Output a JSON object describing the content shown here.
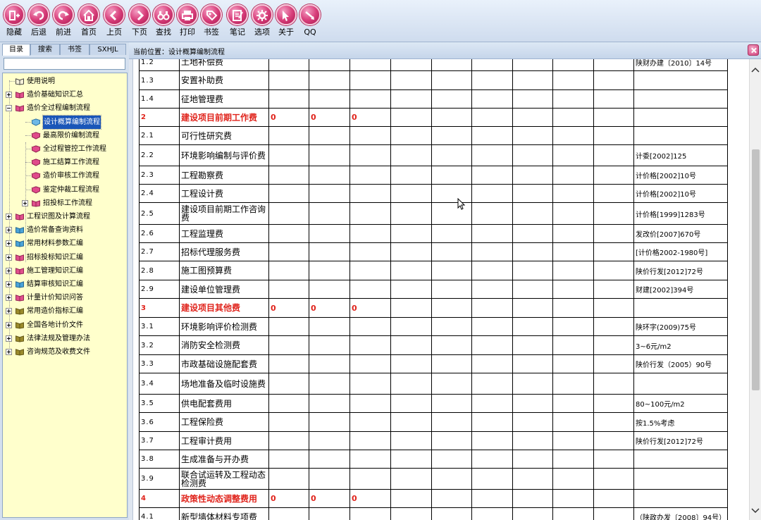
{
  "toolbar": {
    "buttons": [
      {
        "label": "隐藏",
        "icon": "hide-icon"
      },
      {
        "label": "后退",
        "icon": "back-icon"
      },
      {
        "label": "前进",
        "icon": "forward-icon"
      },
      {
        "label": "首页",
        "icon": "home-icon"
      },
      {
        "label": "上页",
        "icon": "prev-page-icon"
      },
      {
        "label": "下页",
        "icon": "next-page-icon"
      },
      {
        "label": "查找",
        "icon": "binoculars-icon"
      },
      {
        "label": "打印",
        "icon": "printer-icon"
      },
      {
        "label": "书签",
        "icon": "bookmark-tag-icon"
      },
      {
        "label": "笔记",
        "icon": "note-icon"
      },
      {
        "label": "选项",
        "icon": "gear-icon"
      },
      {
        "label": "关于",
        "icon": "cursor-icon"
      },
      {
        "label": "QQ",
        "icon": "qq-icon"
      }
    ]
  },
  "sidebar": {
    "tabs": [
      "目录",
      "搜索",
      "书签",
      "SXHJL"
    ],
    "search": {
      "value": "",
      "placeholder": ""
    },
    "tree": [
      {
        "label": "使用说明",
        "icon": "book-icon",
        "expander": "none"
      },
      {
        "label": "造价基础知识汇总",
        "icon": "pink-book-icon",
        "expander": "plus"
      },
      {
        "label": "造价全过程编制流程",
        "icon": "pink-book-icon",
        "expander": "minus"
      },
      {
        "label": "设计概算编制流程",
        "icon": "blue-doc-icon",
        "expander": "none",
        "selected": true
      },
      {
        "label": "最高限价编制流程",
        "icon": "pink-doc-icon",
        "expander": "none"
      },
      {
        "label": "全过程管控工作流程",
        "icon": "pink-doc-icon",
        "expander": "none"
      },
      {
        "label": "施工结算工作流程",
        "icon": "pink-doc-icon",
        "expander": "none"
      },
      {
        "label": "造价审核工作流程",
        "icon": "pink-doc-icon",
        "expander": "none"
      },
      {
        "label": "鉴定仲裁工程流程",
        "icon": "pink-doc-icon",
        "expander": "none"
      },
      {
        "label": "招投标工作流程",
        "icon": "pink-book-icon",
        "expander": "plus"
      },
      {
        "label": "工程识图及计算流程",
        "icon": "pink-book-icon",
        "expander": "plus"
      },
      {
        "label": "造价常备查询资料",
        "icon": "blue-book-icon",
        "expander": "plus"
      },
      {
        "label": "常用材料参数汇编",
        "icon": "blue-book-icon",
        "expander": "plus"
      },
      {
        "label": "招标投标知识汇编",
        "icon": "pink-book-icon",
        "expander": "plus"
      },
      {
        "label": "施工管理知识汇编",
        "icon": "pink-book-icon",
        "expander": "plus"
      },
      {
        "label": "结算审核知识汇编",
        "icon": "blue-book-icon",
        "expander": "plus"
      },
      {
        "label": "计量计价知识问答",
        "icon": "pink-book-icon",
        "expander": "plus"
      },
      {
        "label": "常用造价指标汇编",
        "icon": "olive-book-icon",
        "expander": "plus"
      },
      {
        "label": "全国各地计价文件",
        "icon": "olive-book-icon",
        "expander": "plus"
      },
      {
        "label": "法律法规及管理办法",
        "icon": "olive-book-icon",
        "expander": "plus"
      },
      {
        "label": "咨询规范及收费文件",
        "icon": "olive-book-icon",
        "expander": "plus"
      }
    ]
  },
  "main": {
    "breadcrumb": "当前位置：设计概算编制流程",
    "rows": [
      {
        "no": "1.2",
        "name": "土地补偿费",
        "values": [
          "",
          "",
          ""
        ],
        "ref": "陕财办建〔2010〕14号",
        "section": false
      },
      {
        "no": "1.3",
        "name": "安置补助费",
        "values": [
          "",
          "",
          ""
        ],
        "ref": "",
        "section": false
      },
      {
        "no": "1.4",
        "name": "征地管理费",
        "values": [
          "",
          "",
          ""
        ],
        "ref": "",
        "section": false
      },
      {
        "no": "2",
        "name": "建设项目前期工作费",
        "values": [
          "0",
          "0",
          "0"
        ],
        "ref": "",
        "section": true
      },
      {
        "no": "2.1",
        "name": "可行性研究费",
        "values": [
          "",
          "",
          ""
        ],
        "ref": "",
        "section": false
      },
      {
        "no": "2.2",
        "name": "环境影响编制与评价费",
        "values": [
          "",
          "",
          ""
        ],
        "ref": "计委[2002]125",
        "section": false
      },
      {
        "no": "2.3",
        "name": "工程勘察费",
        "values": [
          "",
          "",
          ""
        ],
        "ref": "计价格[2002]10号",
        "section": false
      },
      {
        "no": "2.4",
        "name": "工程设计费",
        "values": [
          "",
          "",
          ""
        ],
        "ref": "计价格[2002]10号",
        "section": false
      },
      {
        "no": "2.5",
        "name": "建设项目前期工作咨询费",
        "values": [
          "",
          "",
          ""
        ],
        "ref": "计价格[1999]1283号",
        "section": false
      },
      {
        "no": "2.6",
        "name": "工程监理费",
        "values": [
          "",
          "",
          ""
        ],
        "ref": "发改价[2007]670号",
        "section": false
      },
      {
        "no": "2.7",
        "name": "招标代理服务费",
        "values": [
          "",
          "",
          ""
        ],
        "ref": "[计价格2002-1980号]",
        "section": false
      },
      {
        "no": "2.8",
        "name": "施工图预算费",
        "values": [
          "",
          "",
          ""
        ],
        "ref": "陕价行发[2012]72号",
        "section": false
      },
      {
        "no": "2.9",
        "name": "建设单位管理费",
        "values": [
          "",
          "",
          ""
        ],
        "ref": "财建[2002]394号",
        "section": false
      },
      {
        "no": "3",
        "name": "建设项目其他费",
        "values": [
          "0",
          "0",
          "0"
        ],
        "ref": "",
        "section": true
      },
      {
        "no": "3.1",
        "name": "环境影响评价检测费",
        "values": [
          "",
          "",
          ""
        ],
        "ref": "陕环字(2009)75号",
        "section": false
      },
      {
        "no": "3.2",
        "name": "消防安全检测费",
        "values": [
          "",
          "",
          ""
        ],
        "ref": "3~6元/m2",
        "section": false
      },
      {
        "no": "3.3",
        "name": "市政基础设施配套费",
        "values": [
          "",
          "",
          ""
        ],
        "ref": "陕价行发（2005）90号",
        "section": false
      },
      {
        "no": "3.4",
        "name": "场地准备及临时设施费",
        "values": [
          "",
          "",
          ""
        ],
        "ref": "",
        "section": false
      },
      {
        "no": "3.5",
        "name": "供电配套费用",
        "values": [
          "",
          "",
          ""
        ],
        "ref": "80~100元/m2",
        "section": false
      },
      {
        "no": "3.6",
        "name": "工程保险费",
        "values": [
          "",
          "",
          ""
        ],
        "ref": "按1.5%考虑",
        "section": false
      },
      {
        "no": "3.7",
        "name": "工程审计费用",
        "values": [
          "",
          "",
          ""
        ],
        "ref": "陕价行发[2012]72号",
        "section": false
      },
      {
        "no": "3.8",
        "name": "生成准备与开办费",
        "values": [
          "",
          "",
          ""
        ],
        "ref": "",
        "section": false
      },
      {
        "no": "3.9",
        "name": "联合试运转及工程动态检测费",
        "values": [
          "",
          "",
          ""
        ],
        "ref": "",
        "section": false
      },
      {
        "no": "4",
        "name": "政策性动态调整费用",
        "values": [
          "0",
          "0",
          "0"
        ],
        "ref": "",
        "section": true
      },
      {
        "no": "4.1",
        "name": "新型墙体材料专项费",
        "values": [
          "",
          "",
          ""
        ],
        "ref": "（陕政办发〔2008〕94号）",
        "section": false
      }
    ]
  },
  "colors": {
    "section_red": "#e0241c",
    "tree_background": "#ffffcc",
    "selection_blue": "#1a56b8",
    "toolbar_orb": "#d9407c"
  }
}
